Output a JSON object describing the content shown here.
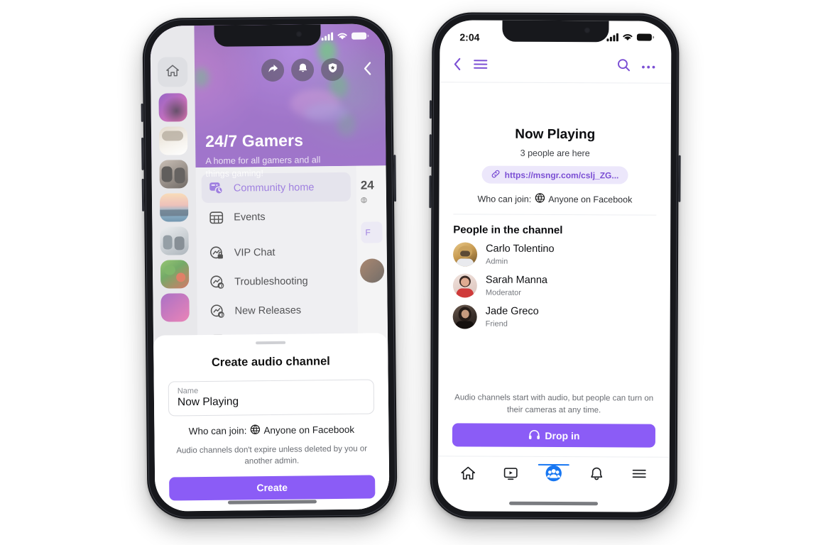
{
  "left_phone": {
    "status_bar": {
      "signal_icon": "cellular-signal-icon",
      "wifi_icon": "wifi-icon",
      "battery_icon": "battery-icon"
    },
    "header": {
      "community_name": "24/7 Gamers",
      "community_tagline": "A home for all gamers and all things gaming!",
      "actions": [
        {
          "icon": "share-icon",
          "name": "share-button"
        },
        {
          "icon": "bell-icon",
          "name": "notifications-button"
        },
        {
          "icon": "shield-star-icon",
          "name": "admin-badge-button"
        }
      ],
      "collapse_icon": "chevron-left-icon"
    },
    "rail": {
      "home_icon": "home-icon",
      "community_thumbnails": [
        {
          "name": "community-thumb-gaming",
          "selected": true,
          "c1": "#6f2bb0",
          "c2": "#e0429c"
        },
        {
          "name": "community-thumb-pets",
          "selected": false,
          "c1": "#d9cdbb",
          "c2": "#f1ece3"
        },
        {
          "name": "community-thumb-friends",
          "selected": false,
          "c1": "#4a3f3a",
          "c2": "#b5a79a"
        },
        {
          "name": "community-thumb-travel",
          "selected": false,
          "c1": "#f3c9a0",
          "c2": "#5d93b5"
        },
        {
          "name": "community-thumb-family",
          "selected": false,
          "c1": "#cfd8de",
          "c2": "#8f9aa3"
        },
        {
          "name": "community-thumb-food",
          "selected": false,
          "c1": "#5fa03a",
          "c2": "#c4462e"
        },
        {
          "name": "community-thumb-music",
          "selected": false,
          "c1": "#8a3bb0",
          "c2": "#e2559c"
        }
      ]
    },
    "menu": [
      {
        "label": "Community home",
        "icon": "community-home-icon",
        "active": true
      },
      {
        "label": "Events",
        "icon": "calendar-grid-icon",
        "active": false
      },
      {
        "label": "VIP Chat",
        "icon": "locked-chat-icon",
        "active": false
      },
      {
        "label": "Troubleshooting",
        "icon": "audio-channel-icon",
        "active": false
      },
      {
        "label": "New Releases",
        "icon": "audio-channel-icon",
        "active": false
      }
    ],
    "peek": {
      "title_fragment": "24",
      "meta_fragment": "",
      "pill_fragment": "F"
    },
    "sheet": {
      "title": "Create audio channel",
      "name_field": {
        "label": "Name",
        "value": "Now Playing",
        "placeholder": "Name"
      },
      "who_can_join_label": "Who can join:",
      "who_can_join_value": "Anyone on Facebook",
      "globe_icon": "globe-icon",
      "note": "Audio channels don't expire unless deleted by you or another admin.",
      "create_button": "Create"
    }
  },
  "right_phone": {
    "status_bar": {
      "time": "2:04",
      "signal_icon": "cellular-signal-icon",
      "wifi_icon": "wifi-icon",
      "battery_icon": "battery-icon"
    },
    "nav": {
      "back_icon": "chevron-left-icon",
      "menu_icon": "hamburger-menu-icon",
      "search_icon": "search-icon",
      "more_icon": "more-horizontal-icon"
    },
    "channel": {
      "title": "Now Playing",
      "people_count": "3 people are here",
      "invite_link": "https://msngr.com/cslj_ZG...",
      "link_icon": "link-chain-icon",
      "who_can_join_label": "Who can join:",
      "who_can_join_value": "Anyone on Facebook",
      "globe_icon": "globe-icon"
    },
    "people_section": {
      "title": "People in the channel",
      "people": [
        {
          "name": "Carlo Tolentino",
          "role": "Admin",
          "c1": "#d7a85c",
          "c2": "#8b6b3a"
        },
        {
          "name": "Sarah Manna",
          "role": "Moderator",
          "c1": "#e8d5d0",
          "c2": "#cf3a3a"
        },
        {
          "name": "Jade Greco",
          "role": "Friend",
          "c1": "#3c3430",
          "c2": "#7d6a5c"
        }
      ]
    },
    "footer_note": "Audio channels start with audio, but people can turn on their cameras at any time.",
    "drop_in_button": {
      "label": "Drop in",
      "icon": "headphones-icon"
    },
    "tabs": [
      {
        "name": "tab-home",
        "icon": "home-icon",
        "active": false
      },
      {
        "name": "tab-watch",
        "icon": "video-play-icon",
        "active": false
      },
      {
        "name": "tab-communities",
        "icon": "people-group-icon",
        "active": true
      },
      {
        "name": "tab-notifications",
        "icon": "bell-icon",
        "active": false
      },
      {
        "name": "tab-menu",
        "icon": "hamburger-menu-icon",
        "active": false
      }
    ]
  },
  "colors": {
    "brand_purple": "#8b5cf6",
    "link_purple": "#7b4fd4",
    "pill_bg": "#ece7fb",
    "facebook_blue": "#1877f2",
    "cover_purple": "#7e3fae"
  }
}
